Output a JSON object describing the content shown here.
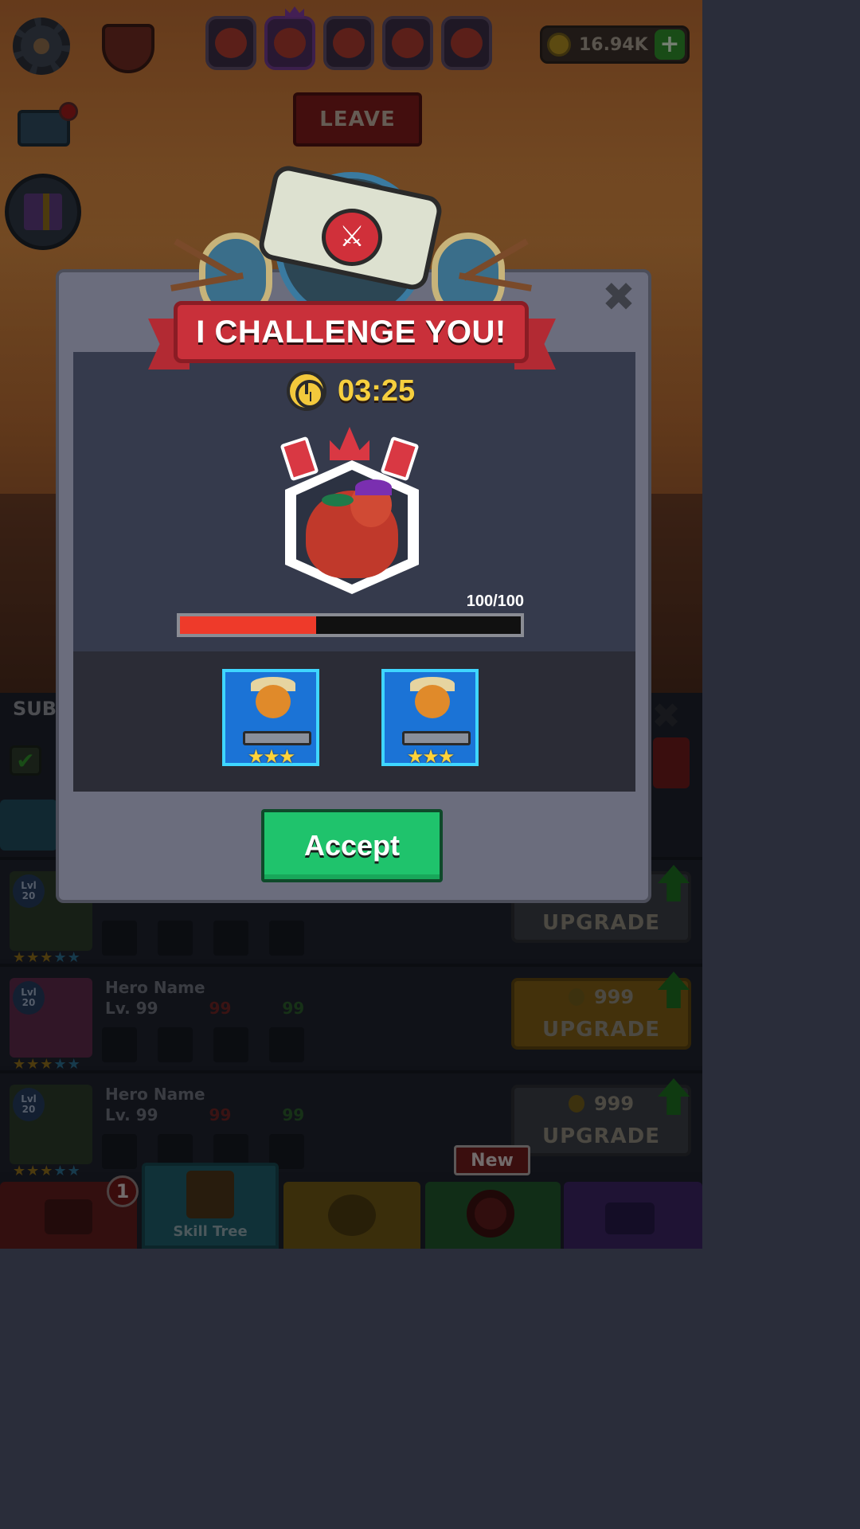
{
  "hud": {
    "coins": "16.94K",
    "plus_icon": "+",
    "leave_label": "LEAVE"
  },
  "modal": {
    "title": "I CHALLENGE YOU!",
    "timer": "03:25",
    "hp_text": "100/100",
    "hp_fill_fraction": 0.4,
    "reward_stars": [
      "★★★",
      "★★★"
    ],
    "accept_label": "Accept",
    "close_icon": "✖",
    "seal_icon": "⚔"
  },
  "background": {
    "sub_label": "SUB",
    "check_icon": "✔",
    "x_icon": "✖",
    "heroes": [
      {
        "level_badge": "Lvl 20",
        "name": "",
        "lv_label": "",
        "stat_red": "",
        "stat_green": "",
        "price": "",
        "upgrade_label": "UPGRADE"
      },
      {
        "level_badge": "Lvl 20",
        "name": "Hero Name",
        "lv_label": "Lv. 99",
        "stat_red": "99",
        "stat_green": "99",
        "price": "999",
        "upgrade_label": "UPGRADE"
      },
      {
        "level_badge": "Lvl 20",
        "name": "Hero Name",
        "lv_label": "Lv. 99",
        "stat_red": "99",
        "stat_green": "99",
        "price": "999",
        "upgrade_label": "UPGRADE"
      }
    ]
  },
  "nav": {
    "skill_tree_label": "Skill Tree",
    "notification_count": "1",
    "new_badge": "New"
  },
  "colors": {
    "accept": "#1fc36c",
    "ribbon": "#c9303a",
    "timer": "#f6cf3e",
    "hp_fill": "#ee3a2a",
    "reward_bg": "#1b73d6"
  }
}
